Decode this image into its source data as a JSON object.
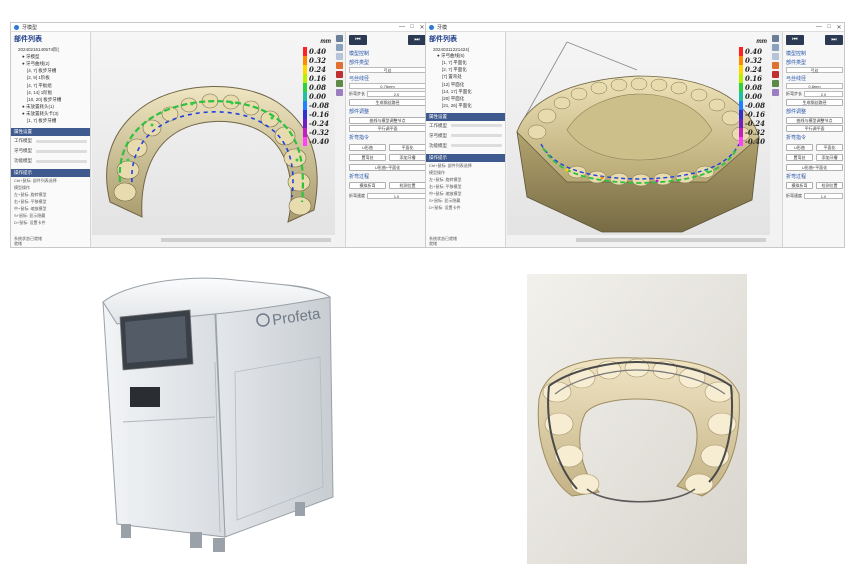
{
  "left_window": {
    "title": "牙模型",
    "window_controls": [
      "—",
      "□",
      "✕"
    ],
    "tree_header": "部件列表",
    "tree_items": [
      {
        "label": "20240216140574阶(",
        "level": 1
      },
      {
        "label": "● 牙模型",
        "level": 2
      },
      {
        "label": "● 牙弓曲线(2)",
        "level": 2
      },
      {
        "label": "[4, 7] 板步牙槽",
        "level": 3
      },
      {
        "label": "[2, 9] 1阶板",
        "level": 3
      },
      {
        "label": "[4, 7] 平板组",
        "level": 3
      },
      {
        "label": "[4, 14] 1阶板",
        "level": 3
      },
      {
        "label": "[10, 20] 板步牙槽",
        "level": 3
      },
      {
        "label": "● 未放置耗头(1)",
        "level": 2
      },
      {
        "label": "● 未放置耗头卡(3)",
        "level": 2
      },
      {
        "label": "[1, 7] 板步牙槽",
        "level": 3
      }
    ],
    "section_props": "属性设置",
    "props": [
      "工作模型",
      "牙弓模型",
      "功能模型"
    ],
    "section_hints": "操作提示",
    "hints": [
      "Ctrl+鼠标: 部件列表选择",
      "模型操作",
      "左+鼠标: 旋转模型",
      "右+鼠标: 平移模型",
      "中+鼠标: 缩放模型",
      "S+鼠标: 显示隐藏",
      "D+鼠标: 设置卡件"
    ],
    "footer": [
      "系统状态已就绪",
      "就绪"
    ],
    "legend_unit": "mm",
    "legend_values": [
      "0.40",
      "0.32",
      "0.24",
      "0.16",
      "0.08",
      "0.00",
      "-0.08",
      "-0.16",
      "-0.24",
      "-0.32",
      "-0.40"
    ],
    "panel": {
      "prev_icon": "⏮",
      "next_icon": "⏭",
      "head1": "模型控制",
      "model_type_label": "部件类型",
      "model_type_value": "弓丝",
      "wire_label": "弓丝线径",
      "wire_value": "0.76mm",
      "param_label": "折弯步长",
      "param_value": "2.0",
      "btn_generate": "生成钢丝路径",
      "head2": "部件调整",
      "btn_fit": "曲线与模型调整节点",
      "btn_plane": "平行调平面",
      "head3": "折弯指令",
      "btn_u": "U形曲",
      "btn_flat": "平面化",
      "btn_wave": "置弯处",
      "btn_addjoint": "添加牙槽",
      "btn_ushape": "U形曲+平面化",
      "head4": "折弯过程",
      "btn_sim": "模拟折弯",
      "btn_check": "检测位置",
      "rate_label": "折弯速度",
      "rate_value": "1.0"
    }
  },
  "right_window": {
    "title": "牙模",
    "window_controls": [
      "—",
      "□",
      "✕"
    ],
    "tree_header": "部件列表",
    "tree_items": [
      {
        "label": "20240311221424(",
        "level": 1
      },
      {
        "label": "● 牙弓曲线(6)",
        "level": 2
      },
      {
        "label": "[1, 7] 平面化",
        "level": 3
      },
      {
        "label": "[2, 7] 平面化",
        "level": 3
      },
      {
        "label": "[7] 置弯处",
        "level": 3
      },
      {
        "label": "[12] 平面化",
        "level": 3
      },
      {
        "label": "[14, 17] 平面化",
        "level": 3
      },
      {
        "label": "[20] 平面化",
        "level": 3
      },
      {
        "label": "[21, 26] 平面化",
        "level": 3
      }
    ],
    "section_props": "属性设置",
    "props": [
      "工作模型",
      "牙弓模型",
      "功能模型"
    ],
    "section_hints": "操作提示",
    "hints": [
      "Ctrl+鼠标: 部件列表选择",
      "模型操作",
      "左+鼠标: 旋转模型",
      "右+鼠标: 平移模型",
      "中+鼠标: 缩放模型",
      "S+鼠标: 显示隐藏",
      "D+鼠标: 设置卡件"
    ],
    "footer": [
      "系统状态已就绪",
      "就绪"
    ],
    "legend_unit": "mm",
    "legend_values": [
      "0.40",
      "0.32",
      "0.24",
      "0.16",
      "0.08",
      "0.00",
      "-0.08",
      "-0.16",
      "-0.24",
      "-0.32",
      "-0.40"
    ],
    "panel": {
      "prev_icon": "⏮",
      "next_icon": "⏭",
      "head1": "模型控制",
      "model_type_label": "部件类型",
      "model_type_value": "弓丝",
      "wire_label": "弓丝线径",
      "wire_value": "0.8mm",
      "param_label": "折弯步长",
      "param_value": "2.0",
      "btn_generate": "生成钢丝路径",
      "head2": "部件调整",
      "btn_fit": "曲线与模型调整节点",
      "btn_plane": "平行调平面",
      "head3": "折弯指令",
      "btn_u": "U形曲",
      "btn_flat": "平面化",
      "btn_wave": "置弯处",
      "btn_addjoint": "添加牙槽",
      "btn_ushape": "U形曲+平面化",
      "head4": "折弯过程",
      "btn_sim": "模拟折弯",
      "btn_check": "检测位置",
      "rate_label": "折弯速度",
      "rate_value": "1.0"
    }
  },
  "legend_colors": [
    "#ff2020",
    "#ff8a00",
    "#ffd800",
    "#b8f000",
    "#30d040",
    "#20c0a0",
    "#2080ff",
    "#3030d0",
    "#7020c0",
    "#c020c0",
    "#ff40ff"
  ],
  "machine_brand": "Profeta",
  "colors": {
    "model_base": "#d4c898",
    "model_shadow": "#9c8f64",
    "panel_dark": "#2b3a52",
    "machine_body": "#e9ecef",
    "wire": "#5a5a5a"
  }
}
